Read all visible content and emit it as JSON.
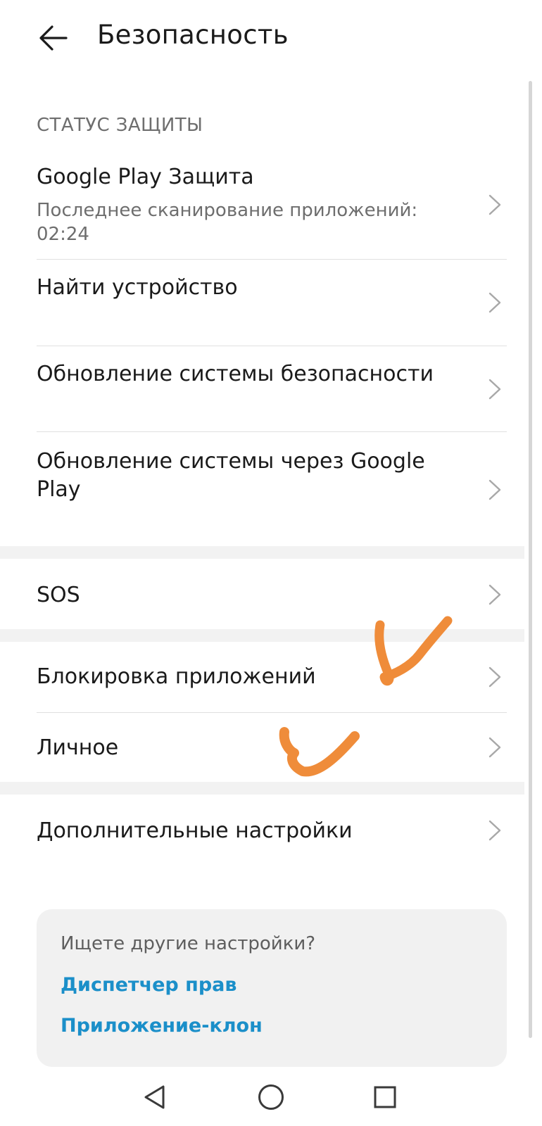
{
  "header": {
    "title": "Безопасность",
    "back_icon": "arrow-left-icon"
  },
  "status_section": {
    "heading": "СТАТУС ЗАЩИТЫ",
    "items": [
      {
        "title": "Google Play Защита",
        "subtitle_line1": "Последнее сканирование приложений:",
        "subtitle_line2": "02:24"
      },
      {
        "title": "Найти устройство"
      },
      {
        "title": "Обновление системы безопасности"
      },
      {
        "title_line1": "Обновление системы через Google",
        "title_line2": "Play"
      }
    ]
  },
  "sos": {
    "title": "SOS"
  },
  "privacy_section": {
    "items": [
      {
        "title": "Блокировка приложений"
      },
      {
        "title": "Личное"
      }
    ]
  },
  "more": {
    "title": "Дополнительные настройки"
  },
  "suggestion_card": {
    "question": "Ищете другие настройки?",
    "links": [
      "Диспетчер прав",
      "Приложение-клон"
    ],
    "link_color": "#1b8fc9"
  },
  "navbar": {
    "icons": [
      "back-triangle-icon",
      "home-circle-icon",
      "recents-square-icon"
    ]
  },
  "annotation_color": "#ef8c3a"
}
